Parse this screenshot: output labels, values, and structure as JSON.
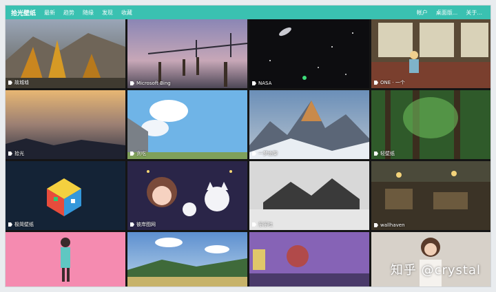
{
  "nav": {
    "brand": "拾光壁纸",
    "left_links": [
      "最新",
      "趋势",
      "随缘",
      "发现",
      "收藏"
    ],
    "right_links": [
      "帐户",
      "桌面版...",
      "关于..."
    ]
  },
  "tiles": [
    {
      "label": "故城墟"
    },
    {
      "label": "Microsoft Bing"
    },
    {
      "label": "NASA"
    },
    {
      "label": "ONE · 一个"
    },
    {
      "label": "拾光"
    },
    {
      "label": "贪吃"
    },
    {
      "label": "一梦幽黎"
    },
    {
      "label": "轻壁纸"
    },
    {
      "label": "极简壁纸"
    },
    {
      "label": "彼岸图网"
    },
    {
      "label": "乐乐吐"
    },
    {
      "label": "wallhaven"
    },
    {
      "label": ""
    },
    {
      "label": ""
    },
    {
      "label": ""
    },
    {
      "label": ""
    }
  ],
  "watermark": "知乎 @crystal",
  "colors": {
    "nav": "#3ac1b1"
  }
}
